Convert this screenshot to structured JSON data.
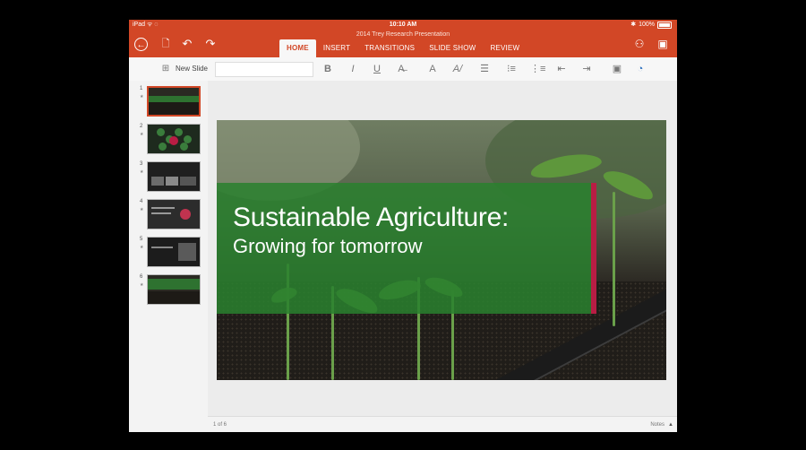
{
  "statusbar": {
    "device": "iPad ᯤ ◌",
    "time": "10:10 AM",
    "battery": "100%"
  },
  "document": {
    "title": "2014 Trey Research Presentation"
  },
  "ribbon": {
    "tabs": [
      "HOME",
      "INSERT",
      "TRANSITIONS",
      "SLIDE SHOW",
      "REVIEW"
    ],
    "active_tab": "HOME"
  },
  "toolbar": {
    "new_slide_label": "New Slide",
    "bold": "B",
    "italic": "I",
    "underline": "U",
    "clear": "A̶",
    "font_color": "A",
    "highlight": "A/"
  },
  "thumbnails": [
    {
      "num": "1",
      "star": "★"
    },
    {
      "num": "2",
      "star": "★"
    },
    {
      "num": "3",
      "star": "★"
    },
    {
      "num": "4",
      "star": "★"
    },
    {
      "num": "5",
      "star": "★"
    },
    {
      "num": "6",
      "star": "★"
    }
  ],
  "slide": {
    "title": "Sustainable Agriculture:",
    "subtitle": "Growing for tomorrow"
  },
  "footer": {
    "page_indicator": "1 of 6",
    "notes_label": "Notes"
  },
  "colors": {
    "accent": "#d24726",
    "band": "#2a802e",
    "bar": "#b81d44"
  }
}
